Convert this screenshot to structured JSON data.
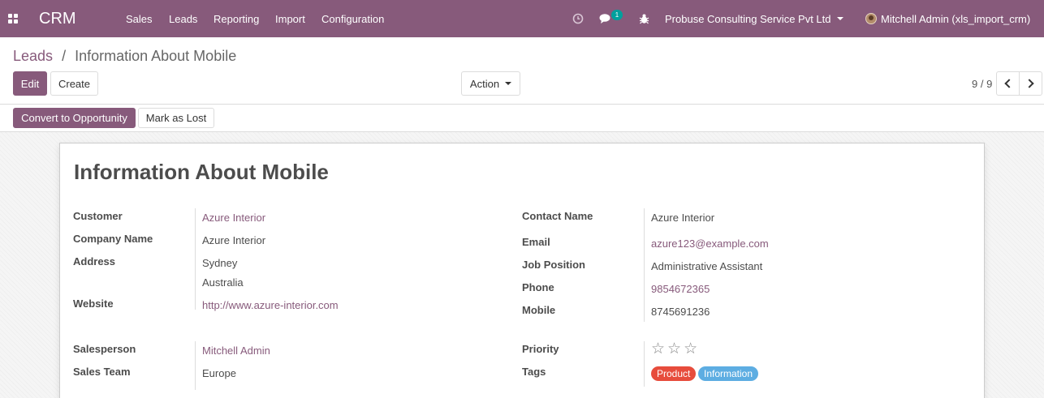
{
  "navbar": {
    "brand": "CRM",
    "menu": [
      "Sales",
      "Leads",
      "Reporting",
      "Import",
      "Configuration"
    ],
    "chat_badge": "1",
    "company": "Probuse Consulting Service Pvt Ltd",
    "user": "Mitchell Admin (xls_import_crm)",
    "bg_color": "#875a7b",
    "icons": [
      "apps-icon",
      "clock-icon",
      "chat-icon",
      "bug-icon"
    ]
  },
  "breadcrumb": {
    "parent": "Leads",
    "separator": "/",
    "current": "Information About Mobile"
  },
  "controls": {
    "edit": "Edit",
    "create": "Create",
    "action": "Action",
    "pager": "9 / 9"
  },
  "statusbar": {
    "convert": "Convert to Opportunity",
    "mark_lost": "Mark as Lost"
  },
  "form": {
    "title": "Information About Mobile",
    "customer_label": "Customer",
    "customer": "Azure Interior",
    "company_name_label": "Company Name",
    "company_name": "Azure Interior",
    "address_label": "Address",
    "address_line1": "Sydney",
    "address_line2": "Australia",
    "website_label": "Website",
    "website": "http://www.azure-interior.com",
    "contact_name_label": "Contact Name",
    "contact_name": "Azure Interior",
    "email_label": "Email",
    "email": "azure123@example.com",
    "job_position_label": "Job Position",
    "job_position": "Administrative Assistant",
    "phone_label": "Phone",
    "phone": "9854672365",
    "mobile_label": "Mobile",
    "mobile": "8745691236",
    "salesperson_label": "Salesperson",
    "salesperson": "Mitchell Admin",
    "sales_team_label": "Sales Team",
    "sales_team": "Europe",
    "priority_label": "Priority",
    "priority_stars": 0,
    "priority_max": 3,
    "tags_label": "Tags",
    "tags": [
      {
        "label": "Product",
        "color": "#e74c3c"
      },
      {
        "label": "Information",
        "color": "#5dade2"
      }
    ]
  }
}
